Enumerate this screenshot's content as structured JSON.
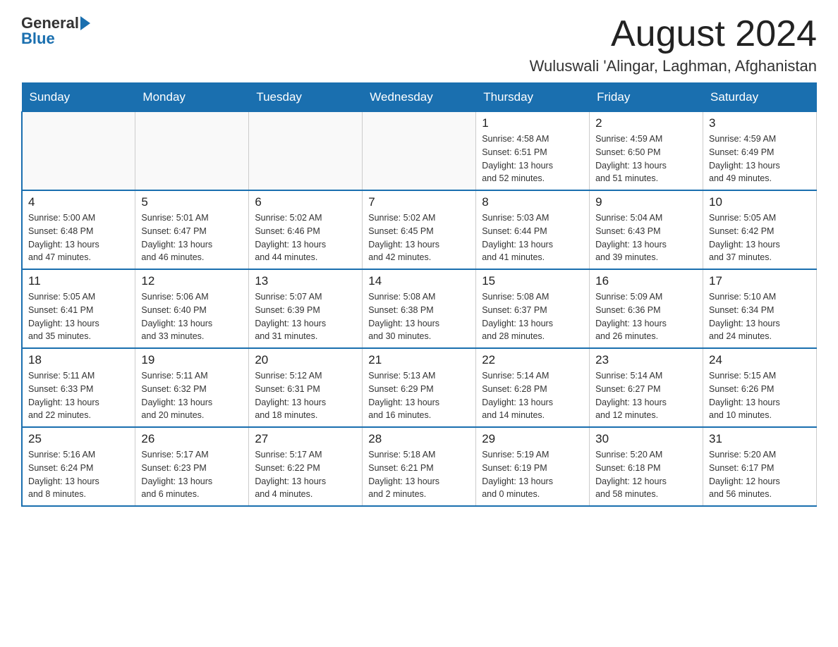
{
  "header": {
    "logo_text_general": "General",
    "logo_text_blue": "Blue",
    "month_title": "August 2024",
    "location": "Wuluswali 'Alingar, Laghman, Afghanistan"
  },
  "days_of_week": [
    "Sunday",
    "Monday",
    "Tuesday",
    "Wednesday",
    "Thursday",
    "Friday",
    "Saturday"
  ],
  "weeks": [
    [
      {
        "day": "",
        "info": ""
      },
      {
        "day": "",
        "info": ""
      },
      {
        "day": "",
        "info": ""
      },
      {
        "day": "",
        "info": ""
      },
      {
        "day": "1",
        "info": "Sunrise: 4:58 AM\nSunset: 6:51 PM\nDaylight: 13 hours\nand 52 minutes."
      },
      {
        "day": "2",
        "info": "Sunrise: 4:59 AM\nSunset: 6:50 PM\nDaylight: 13 hours\nand 51 minutes."
      },
      {
        "day": "3",
        "info": "Sunrise: 4:59 AM\nSunset: 6:49 PM\nDaylight: 13 hours\nand 49 minutes."
      }
    ],
    [
      {
        "day": "4",
        "info": "Sunrise: 5:00 AM\nSunset: 6:48 PM\nDaylight: 13 hours\nand 47 minutes."
      },
      {
        "day": "5",
        "info": "Sunrise: 5:01 AM\nSunset: 6:47 PM\nDaylight: 13 hours\nand 46 minutes."
      },
      {
        "day": "6",
        "info": "Sunrise: 5:02 AM\nSunset: 6:46 PM\nDaylight: 13 hours\nand 44 minutes."
      },
      {
        "day": "7",
        "info": "Sunrise: 5:02 AM\nSunset: 6:45 PM\nDaylight: 13 hours\nand 42 minutes."
      },
      {
        "day": "8",
        "info": "Sunrise: 5:03 AM\nSunset: 6:44 PM\nDaylight: 13 hours\nand 41 minutes."
      },
      {
        "day": "9",
        "info": "Sunrise: 5:04 AM\nSunset: 6:43 PM\nDaylight: 13 hours\nand 39 minutes."
      },
      {
        "day": "10",
        "info": "Sunrise: 5:05 AM\nSunset: 6:42 PM\nDaylight: 13 hours\nand 37 minutes."
      }
    ],
    [
      {
        "day": "11",
        "info": "Sunrise: 5:05 AM\nSunset: 6:41 PM\nDaylight: 13 hours\nand 35 minutes."
      },
      {
        "day": "12",
        "info": "Sunrise: 5:06 AM\nSunset: 6:40 PM\nDaylight: 13 hours\nand 33 minutes."
      },
      {
        "day": "13",
        "info": "Sunrise: 5:07 AM\nSunset: 6:39 PM\nDaylight: 13 hours\nand 31 minutes."
      },
      {
        "day": "14",
        "info": "Sunrise: 5:08 AM\nSunset: 6:38 PM\nDaylight: 13 hours\nand 30 minutes."
      },
      {
        "day": "15",
        "info": "Sunrise: 5:08 AM\nSunset: 6:37 PM\nDaylight: 13 hours\nand 28 minutes."
      },
      {
        "day": "16",
        "info": "Sunrise: 5:09 AM\nSunset: 6:36 PM\nDaylight: 13 hours\nand 26 minutes."
      },
      {
        "day": "17",
        "info": "Sunrise: 5:10 AM\nSunset: 6:34 PM\nDaylight: 13 hours\nand 24 minutes."
      }
    ],
    [
      {
        "day": "18",
        "info": "Sunrise: 5:11 AM\nSunset: 6:33 PM\nDaylight: 13 hours\nand 22 minutes."
      },
      {
        "day": "19",
        "info": "Sunrise: 5:11 AM\nSunset: 6:32 PM\nDaylight: 13 hours\nand 20 minutes."
      },
      {
        "day": "20",
        "info": "Sunrise: 5:12 AM\nSunset: 6:31 PM\nDaylight: 13 hours\nand 18 minutes."
      },
      {
        "day": "21",
        "info": "Sunrise: 5:13 AM\nSunset: 6:29 PM\nDaylight: 13 hours\nand 16 minutes."
      },
      {
        "day": "22",
        "info": "Sunrise: 5:14 AM\nSunset: 6:28 PM\nDaylight: 13 hours\nand 14 minutes."
      },
      {
        "day": "23",
        "info": "Sunrise: 5:14 AM\nSunset: 6:27 PM\nDaylight: 13 hours\nand 12 minutes."
      },
      {
        "day": "24",
        "info": "Sunrise: 5:15 AM\nSunset: 6:26 PM\nDaylight: 13 hours\nand 10 minutes."
      }
    ],
    [
      {
        "day": "25",
        "info": "Sunrise: 5:16 AM\nSunset: 6:24 PM\nDaylight: 13 hours\nand 8 minutes."
      },
      {
        "day": "26",
        "info": "Sunrise: 5:17 AM\nSunset: 6:23 PM\nDaylight: 13 hours\nand 6 minutes."
      },
      {
        "day": "27",
        "info": "Sunrise: 5:17 AM\nSunset: 6:22 PM\nDaylight: 13 hours\nand 4 minutes."
      },
      {
        "day": "28",
        "info": "Sunrise: 5:18 AM\nSunset: 6:21 PM\nDaylight: 13 hours\nand 2 minutes."
      },
      {
        "day": "29",
        "info": "Sunrise: 5:19 AM\nSunset: 6:19 PM\nDaylight: 13 hours\nand 0 minutes."
      },
      {
        "day": "30",
        "info": "Sunrise: 5:20 AM\nSunset: 6:18 PM\nDaylight: 12 hours\nand 58 minutes."
      },
      {
        "day": "31",
        "info": "Sunrise: 5:20 AM\nSunset: 6:17 PM\nDaylight: 12 hours\nand 56 minutes."
      }
    ]
  ]
}
